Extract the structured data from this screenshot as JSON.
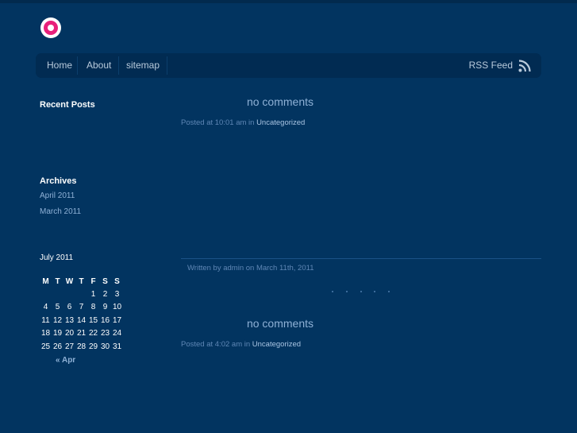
{
  "nav": {
    "items": [
      "Home",
      "About",
      "sitemap"
    ],
    "rss_label": "RSS Feed"
  },
  "sidebar": {
    "recent_posts_title": "Recent Posts",
    "archives_title": "Archives",
    "archives": [
      "April 2011",
      "March 2011"
    ]
  },
  "calendar": {
    "caption": "July 2011",
    "headers": [
      "M",
      "T",
      "W",
      "T",
      "F",
      "S",
      "S"
    ],
    "weeks": [
      [
        "",
        "",
        "",
        "",
        "1",
        "2",
        "3"
      ],
      [
        "4",
        "5",
        "6",
        "7",
        "8",
        "9",
        "10"
      ],
      [
        "11",
        "12",
        "13",
        "14",
        "15",
        "16",
        "17"
      ],
      [
        "18",
        "19",
        "20",
        "21",
        "22",
        "23",
        "24"
      ],
      [
        "25",
        "26",
        "27",
        "28",
        "29",
        "30",
        "31"
      ]
    ],
    "prev_link": "« Apr"
  },
  "posts": [
    {
      "comments": "no comments",
      "posted_prefix": "Posted at 10:01 am in ",
      "category": "Uncategorized",
      "written": "Written by admin on March 11th, 2011"
    },
    {
      "comments": "no comments",
      "posted_prefix": "Posted at 4:02 am in ",
      "category": "Uncategorized"
    }
  ],
  "colors": {
    "background": "#023460",
    "navbar": "#012b52",
    "logo_accent": "#e8207a",
    "link": "#8fb1d6"
  }
}
